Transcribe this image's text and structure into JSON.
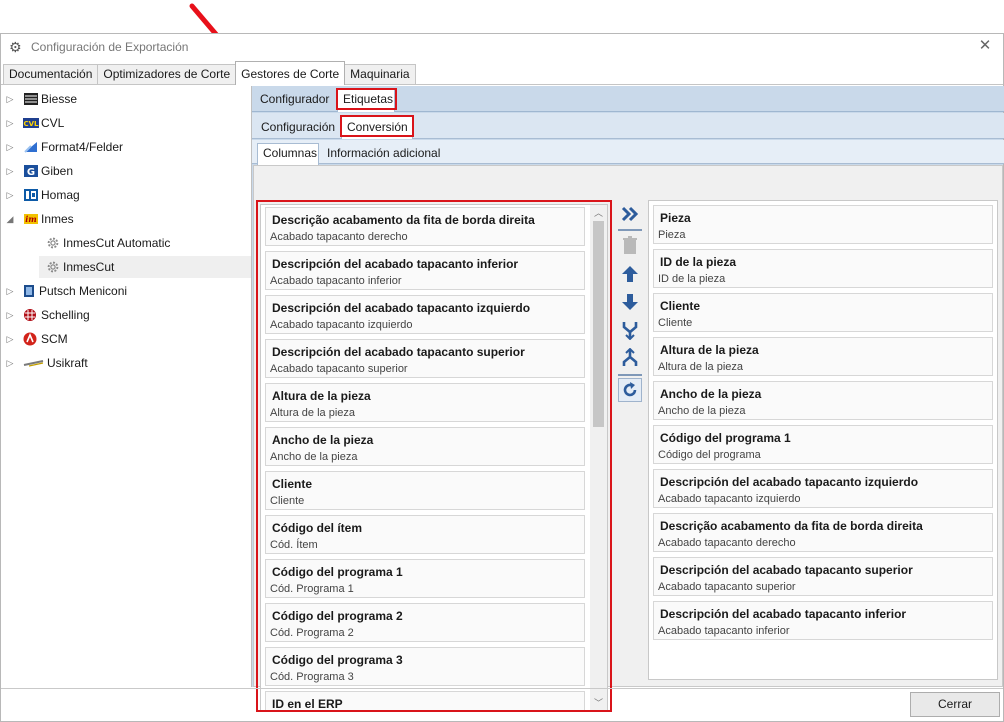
{
  "window": {
    "title": "Configuración de Exportación",
    "close_glyph": "✕"
  },
  "main_tabs": [
    {
      "label": "Documentación",
      "active": false
    },
    {
      "label": "Optimizadores de Corte",
      "active": false
    },
    {
      "label": "Gestores de Corte",
      "active": true
    },
    {
      "label": "Maquinaria",
      "active": false
    }
  ],
  "tree": [
    {
      "label": "Biesse",
      "icon": "biesse-icon",
      "expander": "▷"
    },
    {
      "label": "CVL",
      "icon": "cvl-icon",
      "expander": "▷"
    },
    {
      "label": "Format4/Felder",
      "icon": "format4-icon",
      "expander": "▷"
    },
    {
      "label": "Giben",
      "icon": "giben-icon",
      "expander": "▷"
    },
    {
      "label": "Homag",
      "icon": "homag-icon",
      "expander": "▷"
    },
    {
      "label": "Inmes",
      "icon": "inmes-icon",
      "expander": "◢"
    },
    {
      "label": "InmesCut Automatic",
      "icon": "gear-icon",
      "expander": ""
    },
    {
      "label": "InmesCut",
      "icon": "gear-icon",
      "expander": "",
      "selected": true
    },
    {
      "label": "Putsch Meniconi",
      "icon": "putsch-icon",
      "expander": "▷"
    },
    {
      "label": "Schelling",
      "icon": "schelling-icon",
      "expander": "▷"
    },
    {
      "label": "SCM",
      "icon": "scm-icon",
      "expander": "▷"
    },
    {
      "label": "Usikraft",
      "icon": "usikraft-icon",
      "expander": "▷"
    }
  ],
  "subtabs_level1": {
    "configurador": "Configurador",
    "etiquetas": "Etiquetas"
  },
  "subtabs_level2": {
    "configuracion": "Configuración",
    "conversion": "Conversión"
  },
  "subtabs_level3": {
    "columnas": "Columnas",
    "informacion_adicional": "Información adicional"
  },
  "available_columns": [
    {
      "title": "Descrição acabamento da fita de borda direita",
      "subtitle": "Acabado tapacanto derecho"
    },
    {
      "title": "Descripción del acabado tapacanto inferior",
      "subtitle": "Acabado tapacanto inferior"
    },
    {
      "title": "Descripción del acabado tapacanto izquierdo",
      "subtitle": "Acabado tapacanto izquierdo"
    },
    {
      "title": "Descripción del acabado tapacanto superior",
      "subtitle": "Acabado tapacanto superior"
    },
    {
      "title": "Altura de la pieza",
      "subtitle": "Altura de la pieza"
    },
    {
      "title": "Ancho de la pieza",
      "subtitle": "Ancho de la pieza"
    },
    {
      "title": "Cliente",
      "subtitle": "Cliente"
    },
    {
      "title": "Código del ítem",
      "subtitle": "Cód. Ítem"
    },
    {
      "title": "Código del programa 1",
      "subtitle": "Cód. Programa 1"
    },
    {
      "title": "Código del programa 2",
      "subtitle": "Cód. Programa 2"
    },
    {
      "title": "Código del programa 3",
      "subtitle": "Cód. Programa 3"
    },
    {
      "title": "ID en el ERP",
      "subtitle": ""
    }
  ],
  "selected_columns": [
    {
      "title": "Pieza",
      "subtitle": "Pieza"
    },
    {
      "title": "ID de la pieza",
      "subtitle": "ID de la pieza"
    },
    {
      "title": "Cliente",
      "subtitle": "Cliente"
    },
    {
      "title": "Altura de la pieza",
      "subtitle": "Altura de la pieza"
    },
    {
      "title": "Ancho de la pieza",
      "subtitle": "Ancho de la pieza"
    },
    {
      "title": "Código del programa 1",
      "subtitle": "Código del programa"
    },
    {
      "title": "Descripción del acabado tapacanto izquierdo",
      "subtitle": "Acabado tapacanto izquierdo"
    },
    {
      "title": "Descrição acabamento da fita de borda direita",
      "subtitle": "Acabado tapacanto derecho"
    },
    {
      "title": "Descripción del acabado tapacanto superior",
      "subtitle": "Acabado tapacanto superior"
    },
    {
      "title": "Descripción del acabado tapacanto inferior",
      "subtitle": "Acabado tapacanto inferior"
    }
  ],
  "toolbar": {
    "add_all": "double-chevron-right-icon",
    "delete": "trash-icon",
    "move_up": "arrow-up-icon",
    "move_down": "arrow-down-icon",
    "merge": "merge-icon",
    "split": "split-icon",
    "refresh": "refresh-icon"
  },
  "footer": {
    "close_label": "Cerrar"
  },
  "colors": {
    "accent_blue": "#2d5c9c",
    "highlight_red": "#d9141a",
    "annotation_arrow": "#e8101a"
  }
}
